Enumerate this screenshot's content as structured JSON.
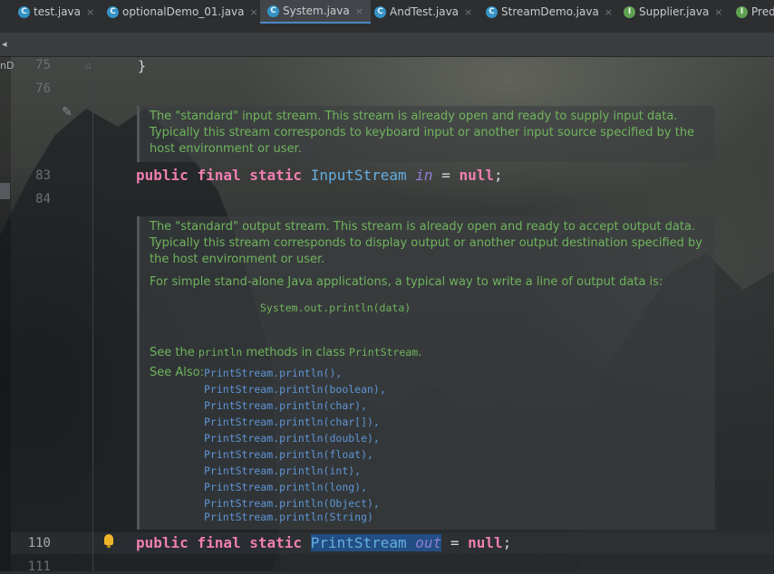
{
  "tabs": [
    {
      "label": "test.java",
      "icon": "class-icon",
      "active": false
    },
    {
      "label": "optionalDemo_01.java",
      "icon": "class-icon",
      "active": false
    },
    {
      "label": "System.java",
      "icon": "class-icon",
      "active": true
    },
    {
      "label": "AndTest.java",
      "icon": "class-icon",
      "active": false
    },
    {
      "label": "StreamDemo.java",
      "icon": "class-icon",
      "active": false
    },
    {
      "label": "Supplier.java",
      "icon": "interface-icon",
      "active": false
    },
    {
      "label": "Pred",
      "icon": "interface-icon",
      "active": false
    }
  ],
  "tab_close_glyph": "×",
  "tab_icon_letters": {
    "class": "C",
    "interface": "I"
  },
  "left_panel_label": "nD",
  "line_numbers": {
    "l75": "75",
    "l76": "76",
    "l83": "83",
    "l84": "84",
    "l110": "110",
    "l111": "111"
  },
  "code": {
    "brace": "}",
    "in_line": {
      "kw1": "public",
      "kw2": "final",
      "kw3": "static",
      "type": "InputStream",
      "field": "in",
      "op": " = ",
      "value": "null",
      "end": ";"
    },
    "out_line": {
      "kw1": "public",
      "kw2": "final",
      "kw3": "static",
      "type": "PrintStream",
      "field": "out",
      "op": " = ",
      "value": "null",
      "end": ";"
    }
  },
  "doc_in": {
    "text": "The \"standard\" input stream. This stream is already open and ready to supply input data. Typically this stream corresponds to keyboard input or another input source specified by the host environment or user."
  },
  "doc_out": {
    "para1": "The \"standard\" output stream. This stream is already open and ready to accept output data. Typically this stream corresponds to display output or another output destination specified by the host environment or user.",
    "para2": "For simple stand-alone Java applications, a typical way to write a line of output data is:",
    "example": "System.out.println(data)",
    "see_pre": "See the ",
    "see_code1": "println",
    "see_mid": " methods in class ",
    "see_code2": "PrintStream",
    "see_post": ".",
    "see_also_label": "See Also:",
    "see_also": [
      "PrintStream.println(),",
      "PrintStream.println(boolean),",
      "PrintStream.println(char),",
      "PrintStream.println(char[]),",
      "PrintStream.println(double),",
      "PrintStream.println(float),",
      "PrintStream.println(int),",
      "PrintStream.println(long),",
      "PrintStream.println(Object),",
      "PrintStream.println(String)"
    ]
  },
  "colors": {
    "keyword": "#ef7fb0",
    "type": "#65aee0",
    "field": "#8e7fd6",
    "doc_text": "#6fb45d",
    "link": "#5e95d6",
    "selection": "#234e83"
  }
}
